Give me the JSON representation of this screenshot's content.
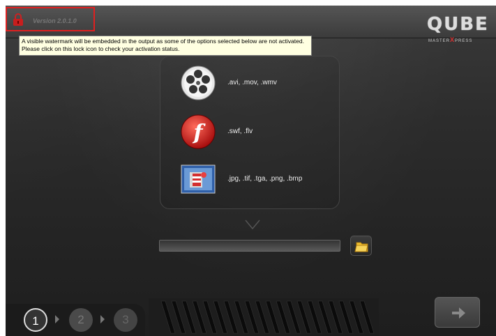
{
  "header": {
    "version": "Version 2.0.1.0",
    "tooltip_lines": [
      "A visible watermark will be embedded in the output as some of the options selected below are not activated.",
      "Please click on this lock icon to check your activation status."
    ]
  },
  "logo": {
    "title": "QUBE",
    "sub_left": "MASTER",
    "sub_x": "X",
    "sub_right": "PRESS"
  },
  "formats": [
    {
      "icon": "film-reel-icon",
      "label": ".avi, .mov, .wmv"
    },
    {
      "icon": "flash-icon",
      "label": ".swf, .flv"
    },
    {
      "icon": "image-sequence-icon",
      "label": ".jpg, .tif, .tga, .png, .bmp"
    }
  ],
  "steps": [
    "1",
    "2",
    "3"
  ],
  "output_path": {
    "value": ""
  },
  "colors": {
    "highlight": "#e02020",
    "tooltip_bg": "#ffffe1",
    "flash_red": "#d42020",
    "folder": "#f2c230"
  }
}
